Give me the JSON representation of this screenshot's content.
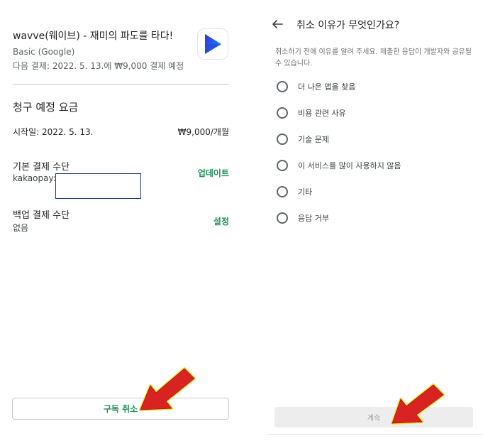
{
  "left_panel": {
    "app_title": "wavve(웨이브) - 재미의 파도를 타다!",
    "plan": "Basic (Google)",
    "next_payment": "다음 결제: 2022. 5. 13.에 ₩9,000 결제 예정",
    "app_icon": "wavve-play-icon",
    "section_title": "청구 예정 요금",
    "start_label": "시작일: 2022. 5. 13.",
    "start_price": "₩9,000/개월",
    "primary_payment_title": "기본 결제 수단",
    "primary_payment_method": "kakaopay:",
    "update_link": "업데이트",
    "backup_payment_title": "백업 결제 수단",
    "backup_payment_value": "없음",
    "setup_link": "설정",
    "cancel_button": "구독 취소"
  },
  "right_panel": {
    "back_icon": "arrow-left-icon",
    "title": "취소 이유가 무엇인가요?",
    "description": "취소하기 전에 이유를 알려 주세요. 제출한 응답이 개발자와 공유될 수 있습니다.",
    "options": [
      {
        "label": "더 나은 앱을 찾음"
      },
      {
        "label": "비용 관련 사유"
      },
      {
        "label": "기술 문제"
      },
      {
        "label": "이 서비스를 많이 사용하지 않음"
      },
      {
        "label": "기타"
      },
      {
        "label": "응답 거부"
      }
    ],
    "continue_button": "계속"
  },
  "colors": {
    "accent_green": "#1e8e5a",
    "annotation_arrow": "#d92323",
    "annotation_glow": "#f5ea3c"
  }
}
